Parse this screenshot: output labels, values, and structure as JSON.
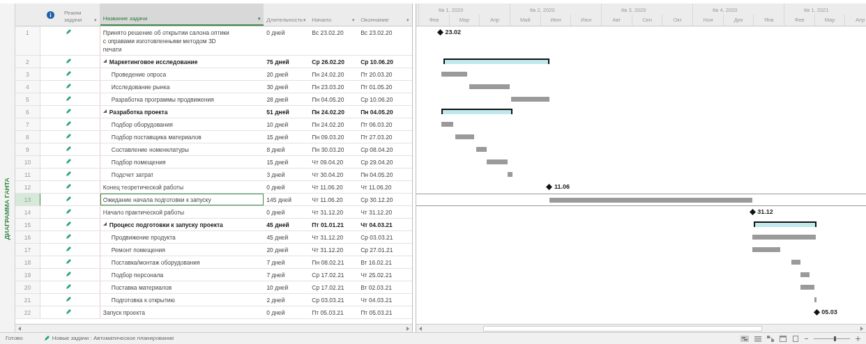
{
  "side_tab": "ДИАГРАММА ГАНТА",
  "columns": {
    "mode": {
      "label": "Режим задачи",
      "menu": "▾"
    },
    "name": {
      "label": "Название задачи",
      "menu": "▾"
    },
    "duration": {
      "label": "Длительность",
      "menu": "▾"
    },
    "start": {
      "label": "Начало",
      "menu": "▾"
    },
    "finish": {
      "label": "Окончание",
      "menu": "▾"
    }
  },
  "zoom_slider": {
    "level": 0.6
  },
  "timescale": {
    "quarters": [
      "Кв 1, 2020",
      "Кв 2, 2020",
      "Кв 3, 2020",
      "Кв 4, 2020",
      "Кв 1, 2021"
    ],
    "months": [
      "Фев",
      "Мар",
      "Апр",
      "Май",
      "Июн",
      "Июл",
      "Авг",
      "Сен",
      "Окт",
      "Ноя",
      "Дек",
      "Янв",
      "Фев",
      "Мар",
      "Апр"
    ]
  },
  "tasks": [
    {
      "num": "1",
      "kind": "milestone",
      "name": "Принято решение об открытии салона оптики с оправами изготовленными методом 3D печати",
      "duration": "0 дней",
      "start": "Вс 23.02.20",
      "finish": "Вс 23.02.20",
      "milestone_label": "23.02",
      "selected": false
    },
    {
      "num": "2",
      "kind": "summary",
      "expanded": true,
      "name": "Маркетинговое исследование",
      "duration": "75 дней",
      "start": "Ср 26.02.20",
      "finish": "Ср 10.06.20",
      "selected": false,
      "children": [
        {
          "num": "3",
          "kind": "task",
          "name": "Проведение опроса",
          "duration": "20 дней",
          "start": "Пн 24.02.20",
          "finish": "Пт 20.03.20",
          "selected": false
        },
        {
          "num": "4",
          "kind": "task",
          "name": "Исследование рынка",
          "duration": "30 дней",
          "start": "Пн 23.03.20",
          "finish": "Пт 01.05.20",
          "selected": false
        },
        {
          "num": "5",
          "kind": "task",
          "name": "Разработка программы продвижения",
          "duration": "28 дней",
          "start": "Пн 04.05.20",
          "finish": "Ср 10.06.20",
          "selected": false
        }
      ]
    },
    {
      "num": "6",
      "kind": "summary",
      "expanded": true,
      "name": "Разработка проекта",
      "duration": "51 дней",
      "start": "Пн 24.02.20",
      "finish": "Пн 04.05.20",
      "selected": false,
      "children": [
        {
          "num": "7",
          "kind": "task",
          "name": "Подбор оборудования",
          "duration": "10 дней",
          "start": "Пн 24.02.20",
          "finish": "Пт 06.03.20",
          "selected": false
        },
        {
          "num": "8",
          "kind": "task",
          "name": "Подбор поставщика материалов",
          "duration": "15 дней",
          "start": "Пн 09.03.20",
          "finish": "Пт 27.03.20",
          "selected": false
        },
        {
          "num": "9",
          "kind": "task",
          "name": "Составление номенклатуры",
          "duration": "8 дней",
          "start": "Пн 30.03.20",
          "finish": "Ср 08.04.20",
          "selected": false
        },
        {
          "num": "10",
          "kind": "task",
          "name": "Подбор помещения",
          "duration": "15 дней",
          "start": "Чт 09.04.20",
          "finish": "Ср 29.04.20",
          "selected": false
        },
        {
          "num": "11",
          "kind": "task",
          "name": "Подсчет затрат",
          "duration": "3 дней",
          "start": "Чт 30.04.20",
          "finish": "Пн 04.05.20",
          "selected": false
        }
      ]
    },
    {
      "num": "12",
      "kind": "milestone",
      "name": "Конец теоретической работы",
      "duration": "0 дней",
      "start": "Чт 11.06.20",
      "finish": "Чт 11.06.20",
      "milestone_label": "11.06",
      "selected": false
    },
    {
      "num": "13",
      "kind": "task",
      "name": "Ожидание начала подготовки к запуску",
      "duration": "145 дней",
      "start": "Чт 11.06.20",
      "finish": "Ср 30.12.20",
      "selected": true
    },
    {
      "num": "14",
      "kind": "milestone",
      "name": "Начало практической работы",
      "duration": "0 дней",
      "start": "Чт 31.12.20",
      "finish": "Чт 31.12.20",
      "milestone_label": "31.12",
      "selected": false
    },
    {
      "num": "15",
      "kind": "summary",
      "expanded": true,
      "name": "Процесс подготовки к запуску проекта",
      "duration": "45 дней",
      "start": "Пт 01.01.21",
      "finish": "Чт 04.03.21",
      "selected": false,
      "children": [
        {
          "num": "16",
          "kind": "task",
          "name": "Продвижение продукта",
          "duration": "45 дней",
          "start": "Чт 31.12.20",
          "finish": "Ср 03.03.21",
          "selected": false
        },
        {
          "num": "17",
          "kind": "task",
          "name": "Ремонт помещения",
          "duration": "20 дней",
          "start": "Чт 31.12.20",
          "finish": "Ср 27.01.21",
          "selected": false
        },
        {
          "num": "18",
          "kind": "task",
          "name": "Поставка/монтаж оборудования",
          "duration": "7 дней",
          "start": "Пн 08.02.21",
          "finish": "Вт 16.02.21",
          "selected": false
        },
        {
          "num": "19",
          "kind": "task",
          "name": "Подбор персонала",
          "duration": "7 дней",
          "start": "Ср 17.02.21",
          "finish": "Чт 25.02.21",
          "selected": false
        },
        {
          "num": "20",
          "kind": "task",
          "name": "Поставка материалов",
          "duration": "10 дней",
          "start": "Ср 17.02.21",
          "finish": "Вт 02.03.21",
          "selected": false
        },
        {
          "num": "21",
          "kind": "task",
          "name": "Подготовка к открытию",
          "duration": "2 дней",
          "start": "Ср 03.03.21",
          "finish": "Чт 04.03.21",
          "selected": false
        }
      ]
    },
    {
      "num": "22",
      "kind": "milestone",
      "name": "Запуск проекта",
      "duration": "0 дней",
      "start": "Пт 05.03.21",
      "finish": "Пт 05.03.21",
      "milestone_label": "05.03",
      "selected": false
    }
  ],
  "status_bar": {
    "state": "Готово",
    "new_tasks": "Новые задачи : Автоматическое планирование"
  }
}
